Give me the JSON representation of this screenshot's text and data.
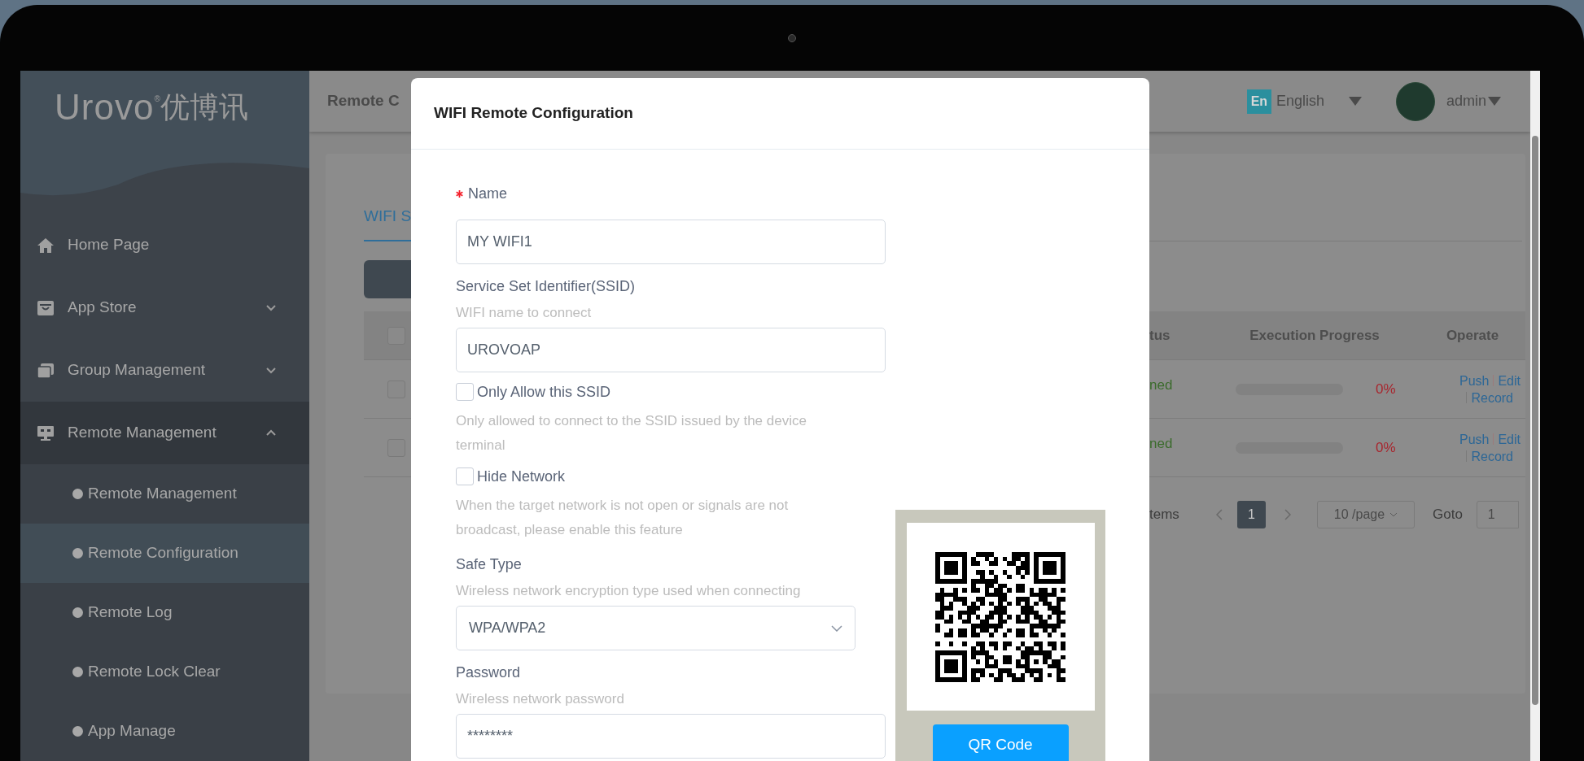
{
  "sidebar": {
    "logo": "Urovo",
    "logo_mark": "®",
    "logo_cn": "优博讯",
    "items": [
      {
        "kind": "link",
        "label": "Home Page"
      },
      {
        "kind": "group",
        "label": "App Store",
        "expanded": false
      },
      {
        "kind": "group",
        "label": "Group Management",
        "expanded": false
      },
      {
        "kind": "group",
        "label": "Remote Management",
        "expanded": true,
        "children": [
          {
            "label": "Remote Management",
            "selected": false
          },
          {
            "label": "Remote Configuration",
            "selected": true
          },
          {
            "label": "Remote Log",
            "selected": false
          },
          {
            "label": "Remote Lock Clear",
            "selected": false
          },
          {
            "label": "App Manage",
            "selected": false
          }
        ]
      }
    ]
  },
  "header": {
    "breadcrumb": "Remote C",
    "language": {
      "badge": "En",
      "label": "English"
    },
    "user": {
      "name": "admin"
    }
  },
  "content": {
    "tab": "WIFI S",
    "table": {
      "header_checked": false,
      "columns": [
        "tus",
        "Execution Progress",
        "Operate"
      ],
      "rows": [
        {
          "checked": false,
          "status": "ned",
          "progress": "0%",
          "actions": [
            "Push",
            "Edit",
            "Record"
          ]
        },
        {
          "checked": false,
          "status": "ned",
          "progress": "0%",
          "actions": [
            "Push",
            "Edit",
            "Record"
          ]
        }
      ]
    },
    "pagination": {
      "total": "tems",
      "pages": [
        {
          "label": "1",
          "selected": true
        }
      ],
      "page_size": "10 /page",
      "goto_label": "Goto",
      "goto_value": "1"
    }
  },
  "modal": {
    "title": "WIFI Remote Configuration",
    "fields": [
      {
        "kind": "text",
        "label": "Name",
        "required": true,
        "value": "MY WIFI1"
      },
      {
        "kind": "text",
        "label": "Service Set Identifier(SSID)",
        "required": false,
        "hint": "WIFI name to connect",
        "value": "UROVOAP"
      },
      {
        "kind": "checkbox",
        "label": "Only Allow this SSID",
        "checked": false,
        "help": "Only allowed to connect to the SSID issued by the device terminal"
      },
      {
        "kind": "checkbox",
        "label": "Hide Network",
        "checked": false,
        "help": "When the target network is not open or signals are not broadcast, please enable this feature"
      },
      {
        "kind": "select",
        "label": "Safe Type",
        "required": false,
        "hint": "Wireless network encryption type used when connecting",
        "value": "WPA/WPA2"
      },
      {
        "kind": "text",
        "label": "Password",
        "required": false,
        "hint": "Wireless network password",
        "value": "********"
      }
    ],
    "qr": {
      "button": "QR Code"
    }
  }
}
